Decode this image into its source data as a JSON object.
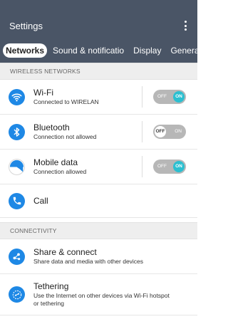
{
  "appbar": {
    "title": "Settings",
    "menu_icon": "more-vert-icon"
  },
  "tabs": [
    {
      "label": "Networks",
      "active": true
    },
    {
      "label": "Sound & notificatio",
      "active": false
    },
    {
      "label": "Display",
      "active": false
    },
    {
      "label": "General",
      "active": false
    }
  ],
  "sections": {
    "wireless": "WIRELESS NETWORKS",
    "connectivity": "CONNECTIVITY"
  },
  "items": {
    "wifi": {
      "title": "Wi-Fi",
      "subtitle": "Connected to WIRELAN",
      "icon": "wifi-icon",
      "toggle": {
        "off_label": "OFF",
        "on_label": "ON",
        "state": "on"
      }
    },
    "bluetooth": {
      "title": "Bluetooth",
      "subtitle": "Connection not allowed",
      "icon": "bluetooth-icon",
      "toggle": {
        "off_label": "OFF",
        "on_label": "ON",
        "state": "off"
      }
    },
    "mobile_data": {
      "title": "Mobile data",
      "subtitle": "Connection allowed",
      "icon": "mobile-data-icon",
      "toggle": {
        "off_label": "OFF",
        "on_label": "ON",
        "state": "on"
      }
    },
    "call": {
      "title": "Call",
      "icon": "phone-icon"
    },
    "share": {
      "title": "Share & connect",
      "subtitle": "Share data and media with other devices",
      "icon": "share-icon"
    },
    "tethering": {
      "title": "Tethering",
      "subtitle": "Use the Internet on other devices via Wi-Fi hotspot or tethering",
      "icon": "tethering-icon"
    }
  },
  "colors": {
    "appbar": "#4a5566",
    "accent": "#1e88e5",
    "toggle_on": "#2bbfd0",
    "toggle_track": "#b7b7b7"
  }
}
